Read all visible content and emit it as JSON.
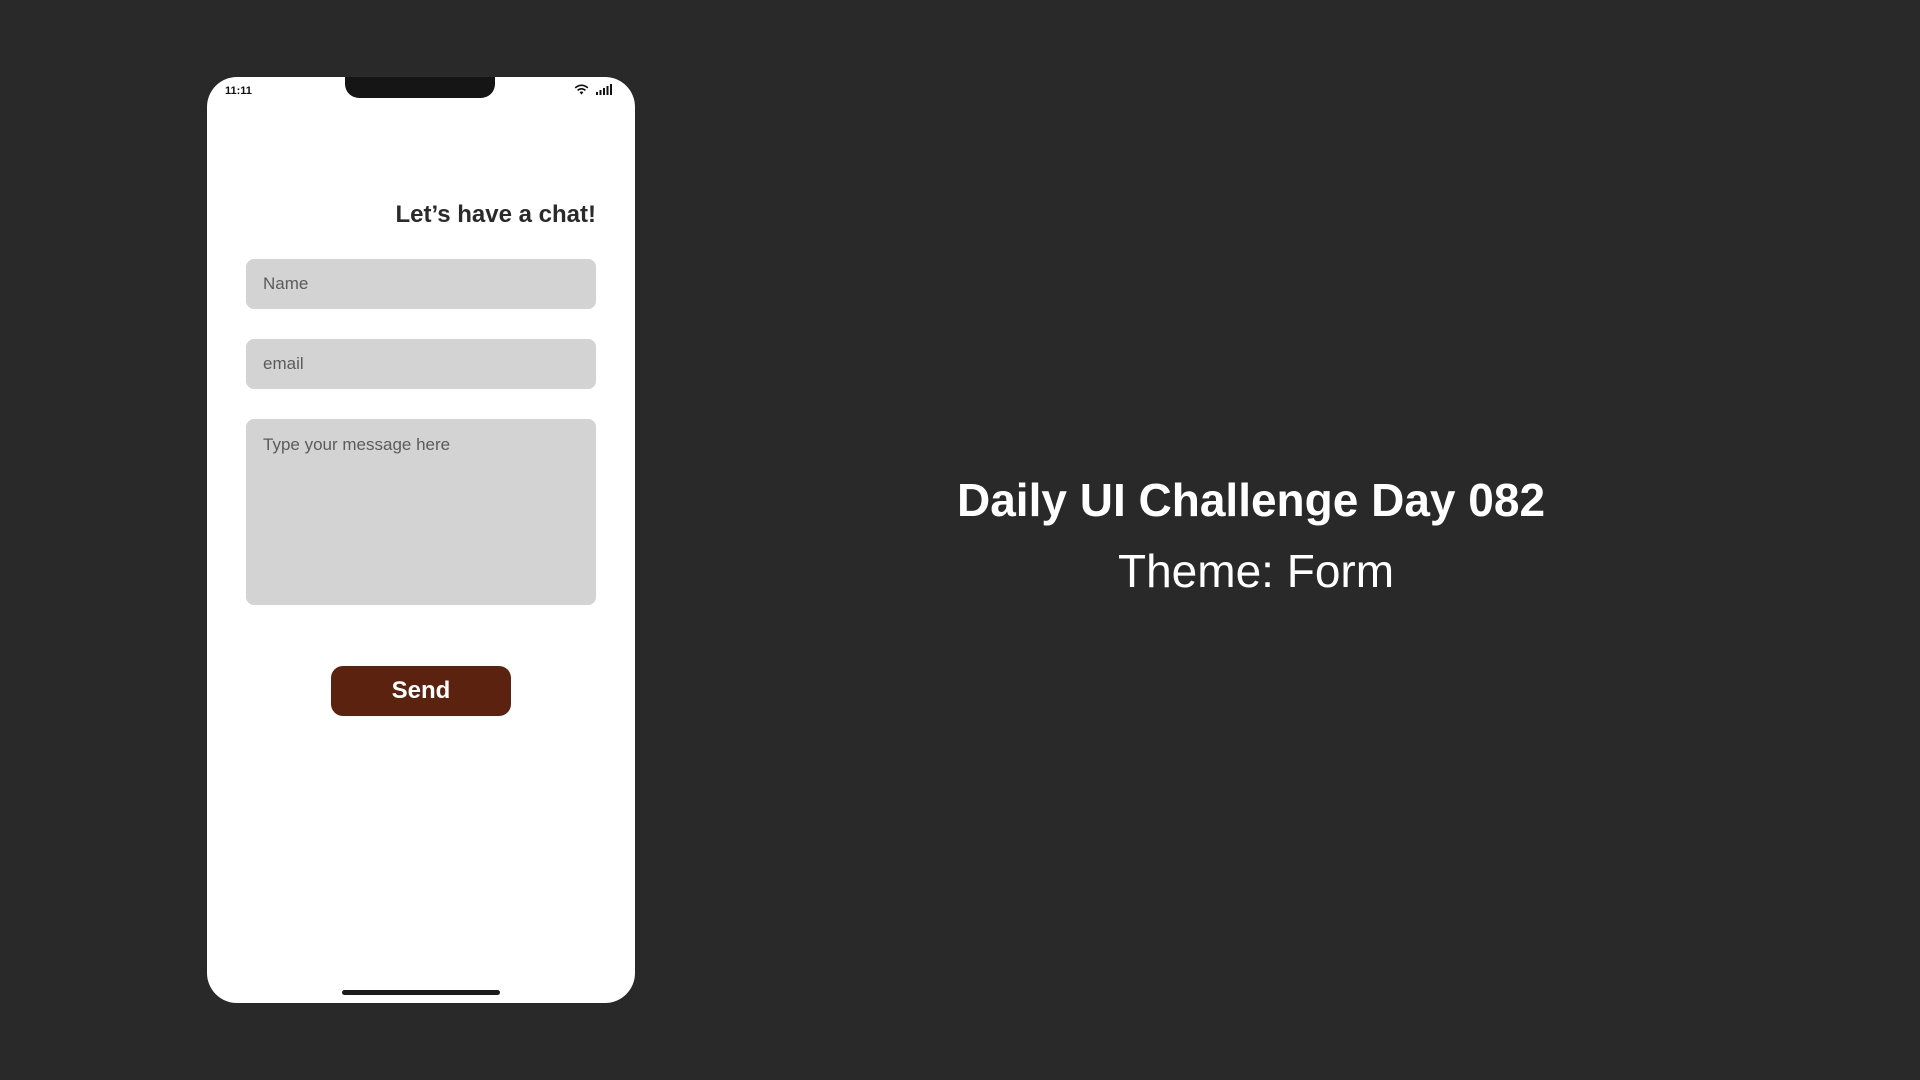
{
  "status_bar": {
    "time": "11:11"
  },
  "form": {
    "heading": "Let’s have a chat!",
    "name_placeholder": "Name",
    "email_placeholder": "email",
    "message_placeholder": "Type your message here",
    "send_label": "Send"
  },
  "presentation": {
    "title": "Daily UI Challenge Day 082",
    "subtitle": "Theme: Form"
  },
  "colors": {
    "background": "#292929",
    "phone": "#ffffff",
    "field": "#d3d3d3",
    "accent": "#5a220f"
  },
  "icons": [
    "wifi-icon",
    "signal-icon"
  ]
}
